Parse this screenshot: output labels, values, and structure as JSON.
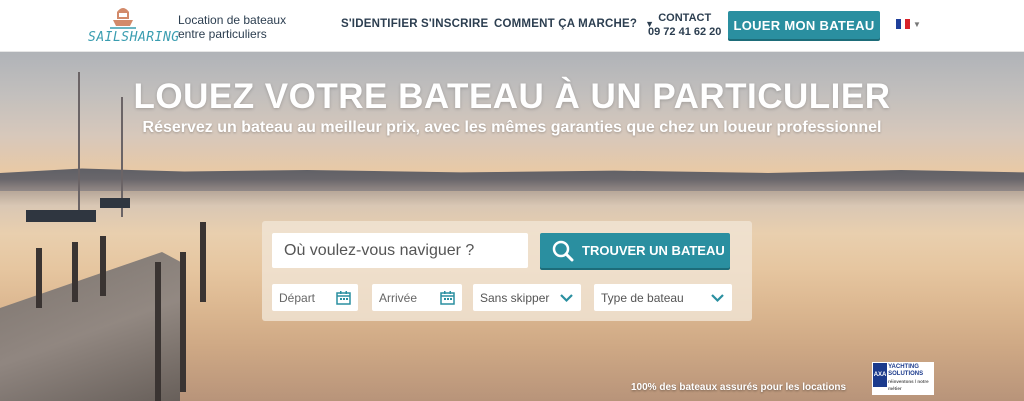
{
  "header": {
    "logo_text": "SAILSHARING",
    "tagline_line1": "Location de bateaux",
    "tagline_line2": "entre particuliers",
    "nav": {
      "login": "S'IDENTIFIER",
      "signup": "S'INSCRIRE",
      "how": "COMMENT ÇA MARCHE?"
    },
    "contact_label": "CONTACT",
    "contact_phone": "09 72 41 62 20",
    "rent_button": "LOUER MON BATEAU",
    "language_flag_icon": "french-flag-icon"
  },
  "hero": {
    "title": "LOUEZ VOTRE BATEAU À UN PARTICULIER",
    "subtitle": "Réservez un bateau au meilleur prix, avec les mêmes garanties que chez un loueur professionnel"
  },
  "search": {
    "placeholder": "Où voulez-vous naviguer ?",
    "button_label": "TROUVER UN BATEAU",
    "departure_placeholder": "Départ",
    "arrival_placeholder": "Arrivée",
    "skipper_value": "Sans skipper",
    "boat_type_value": "Type de bateau"
  },
  "footer": {
    "insured_text": "100% des bateaux assurés pour les locations",
    "partner_logo_mark": "AXA",
    "partner_line1": "YACHTING",
    "partner_line2": "SOLUTIONS",
    "partner_slogan": "réinventons / notre métier"
  },
  "colors": {
    "accent": "#2a8fa0",
    "text_dark": "#2c3e50"
  }
}
